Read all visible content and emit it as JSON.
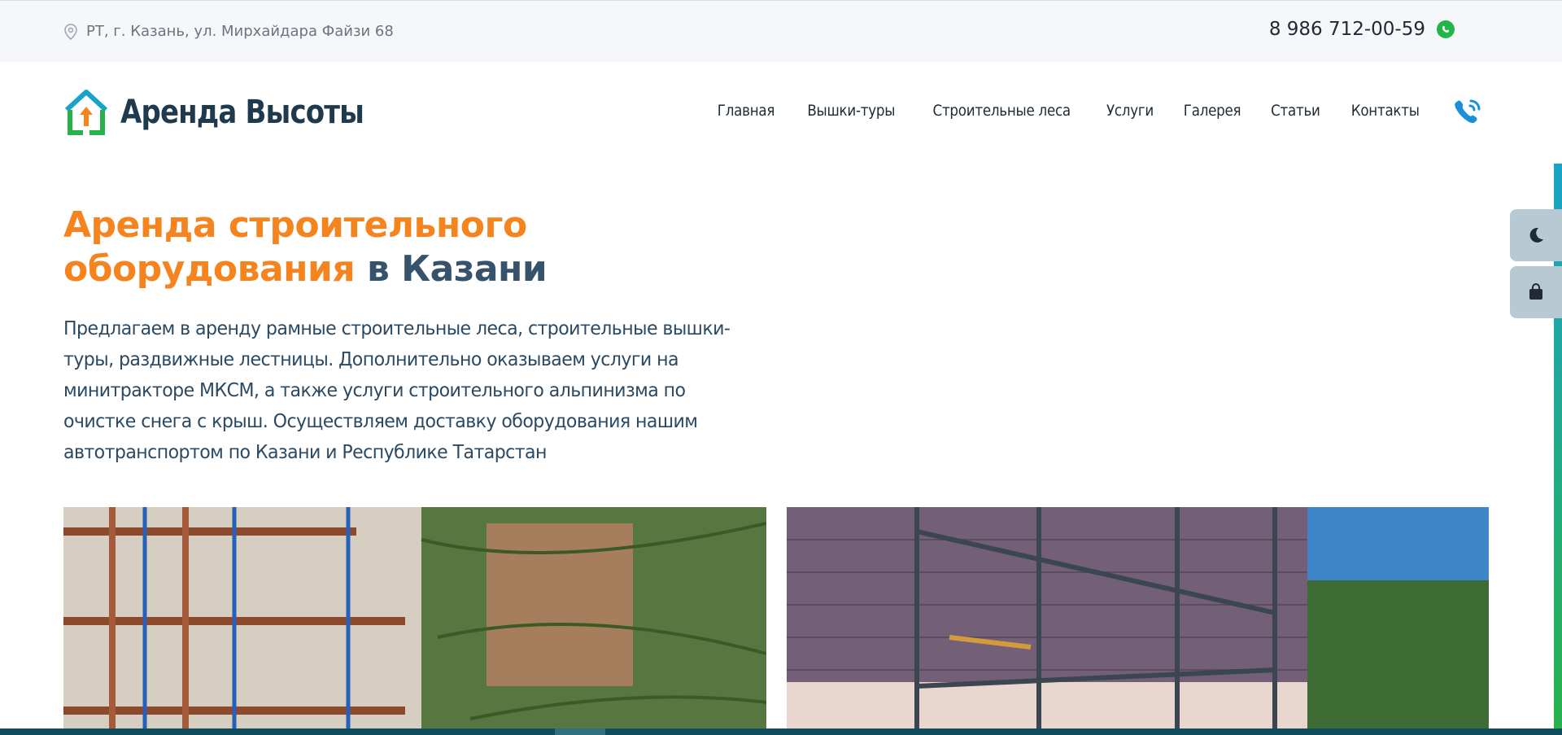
{
  "topbar": {
    "address": "РТ, г. Казань, ул. Мирхайдара Файзи 68",
    "phone": "8 986 712-00-59",
    "address_icon": "location-pin-icon",
    "whatsapp_icon": "whatsapp-icon"
  },
  "header": {
    "logo_text": "Аренда Высоты",
    "nav": [
      "Главная",
      "Вышки-туры",
      "Строительные леса",
      "Услуги",
      "Галерея",
      "Статьи",
      "Контакты"
    ],
    "phone_icon": "phone-call-icon"
  },
  "hero": {
    "title_orange_1": "Аренда строительного",
    "title_orange_2": "оборудования",
    "title_dark": " в Казани",
    "description": "Предлагаем в аренду рамные строительные леса, строительные вышки-туры, раздвижные лестницы. Дополнительно оказываем услуги на минитракторе МКСМ, а также услуги строительного альпинизма по очистке снега с крыш. Осуществляем доставку оборудования нашим автотранспортом по Казани и Республике Татарстан"
  },
  "side_buttons": [
    "moon-icon",
    "shopping-bag-icon"
  ],
  "colors": {
    "accent": "#f5841f",
    "dark": "#36536b",
    "side": "#b7c9d2",
    "whatsapp": "#23b44b"
  }
}
